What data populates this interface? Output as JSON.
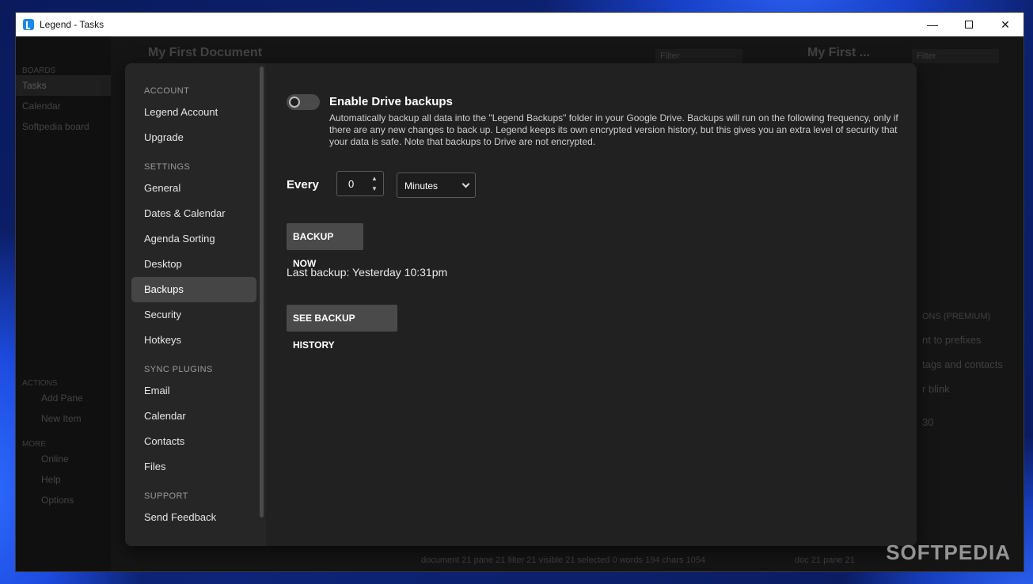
{
  "window": {
    "title": "Legend - Tasks",
    "minimize": "—",
    "close": "✕"
  },
  "background": {
    "boards_label": "BOARDS",
    "boards": [
      "Tasks",
      "Calendar",
      "Softpedia board"
    ],
    "actions_label": "ACTIONS",
    "actions": [
      "Add Pane",
      "New Item"
    ],
    "more_label": "MORE",
    "more": [
      "Online",
      "Help",
      "Options"
    ],
    "doc_title": "My First Document",
    "doc_title2": "My First ...",
    "filter_placeholder": "Filter",
    "status_left": "document 21   pane 21   filter 21   visible 21   selected 0   words 194   chars 1054",
    "status_right": "doc 21   pane 21",
    "right_muted": [
      "ONS (PREMIUM)",
      "nt to prefixes",
      "tags and contacts",
      "r blink",
      "30"
    ]
  },
  "nav": {
    "sections": [
      {
        "label": "ACCOUNT",
        "items": [
          "Legend Account",
          "Upgrade"
        ]
      },
      {
        "label": "SETTINGS",
        "items": [
          "General",
          "Dates & Calendar",
          "Agenda Sorting",
          "Desktop",
          "Backups",
          "Security",
          "Hotkeys"
        ]
      },
      {
        "label": "SYNC PLUGINS",
        "items": [
          "Email",
          "Calendar",
          "Contacts",
          "Files"
        ]
      },
      {
        "label": "SUPPORT",
        "items": [
          "Send Feedback"
        ]
      }
    ],
    "active": "Backups"
  },
  "backups": {
    "toggle_on": false,
    "title": "Enable Drive backups",
    "description": "Automatically backup all data into the \"Legend Backups\" folder in your Google Drive. Backups will run on the following frequency, only if there are any new changes to back up. Legend keeps its own encrypted version history, but this gives you an extra level of security that your data is safe. Note that backups to Drive are not encrypted.",
    "every_label": "Every",
    "interval_value": "0",
    "interval_unit": "Minutes",
    "backup_now_label": "BACKUP NOW",
    "last_backup": "Last backup: Yesterday 10:31pm",
    "history_label": "SEE BACKUP HISTORY"
  },
  "watermark": "SOFTPEDIA",
  "colors": {
    "modal_bg": "#212121",
    "nav_bg": "#262626",
    "active_item": "#454545",
    "button_bg": "#4a4a4a"
  }
}
